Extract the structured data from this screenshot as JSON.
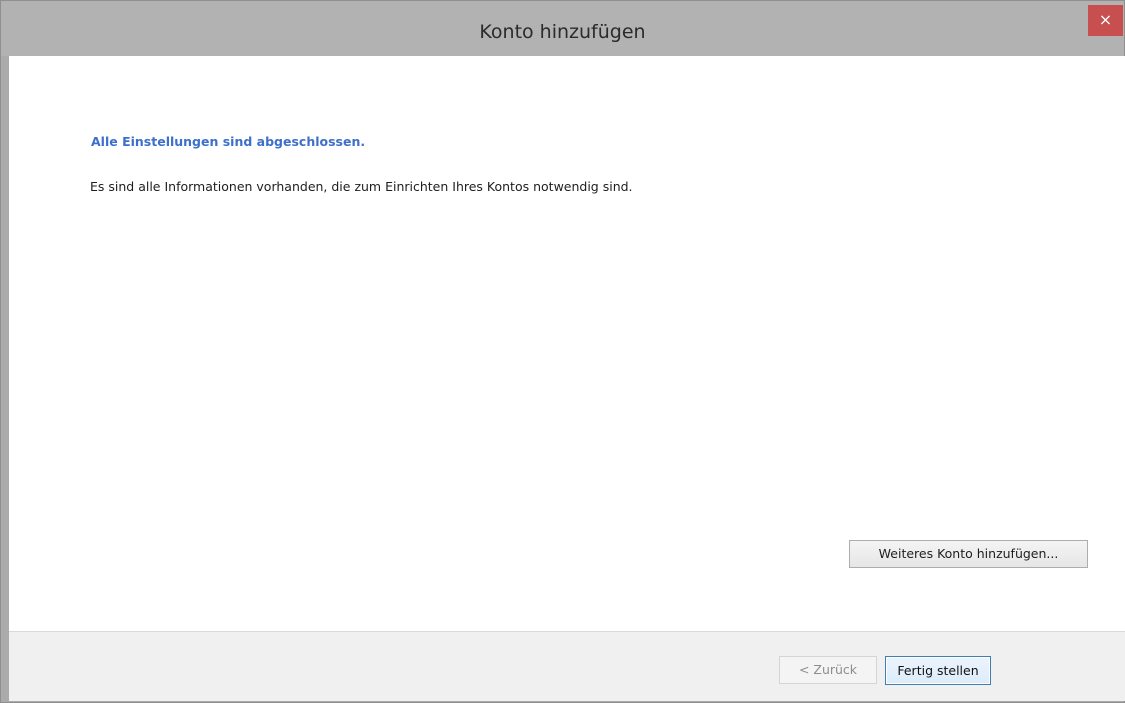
{
  "window": {
    "title": "Konto hinzufügen",
    "close_glyph": "×"
  },
  "content": {
    "heading": "Alle Einstellungen sind abgeschlossen.",
    "description": "Es sind alle Informationen vorhanden, die zum Einrichten Ihres Kontos notwendig sind.",
    "add_another_label": "Weiteres Konto hinzufügen..."
  },
  "footer": {
    "back_label": "< Zurück",
    "finish_label": "Fertig stellen"
  },
  "icons": {
    "close": "close-icon"
  },
  "colors": {
    "heading": "#3d6fcc",
    "close_button": "#c74f4f",
    "titlebar": "#b2b2b2",
    "default_button_border": "#3c7fb1"
  }
}
